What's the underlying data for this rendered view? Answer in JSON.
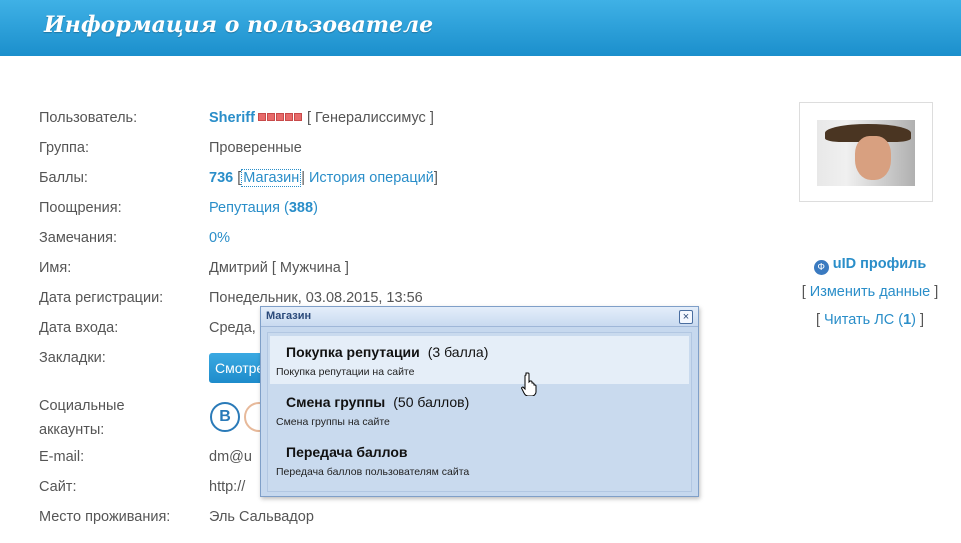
{
  "header": {
    "title": "Информация о пользователе"
  },
  "profile": {
    "user_label": "Пользователь:",
    "username": "Sheriff",
    "rank": "[ Генералиссимус ]",
    "group_label": "Группа:",
    "group": "Проверенные",
    "points_label": "Баллы:",
    "points": "736",
    "shop_link": "Магазин",
    "history_link": "История операций",
    "rewards_label": "Поощрения:",
    "reputation_text": "Репутация (",
    "reputation_value": "388",
    "reputation_close": ")",
    "warnings_label": "Замечания:",
    "warnings": "0%",
    "name_label": "Имя:",
    "name": "Дмитрий",
    "gender": "[ Мужчина ]",
    "reg_label": "Дата регистрации:",
    "reg_date": "Понедельник, 03.08.2015, 13:56",
    "login_label": "Дата входа:",
    "login_date": "Среда,",
    "bookmarks_label": "Закладки:",
    "bookmarks_button": "Смотре",
    "social_label_1": "Социальные",
    "social_label_2": "аккаунты:",
    "social_vk": "B",
    "email_label": "E-mail:",
    "email": "dm@u",
    "site_label": "Сайт:",
    "site": "http://",
    "location_label": "Место проживания:",
    "location": "Эль Сальвадор"
  },
  "sidebar": {
    "uid_profile": "uID профиль",
    "edit_data": "Изменить данные",
    "read_pm_text": "Читать ЛС (",
    "read_pm_count": "1",
    "read_pm_close": ")"
  },
  "modal": {
    "title": "Магазин",
    "close": "×",
    "items": [
      {
        "name": "Покупка репутации",
        "price": "(3 балла)",
        "desc": "Покупка репутации на сайте"
      },
      {
        "name": "Смена группы",
        "price": "(50 баллов)",
        "desc": "Смена группы на сайте"
      },
      {
        "name": "Передача баллов",
        "price": "",
        "desc": "Передача баллов пользователям сайта"
      }
    ]
  },
  "colors": {
    "accent": "#2a8ec9",
    "header": "#1b8fcc",
    "modal_bg": "#c6d8ee"
  }
}
